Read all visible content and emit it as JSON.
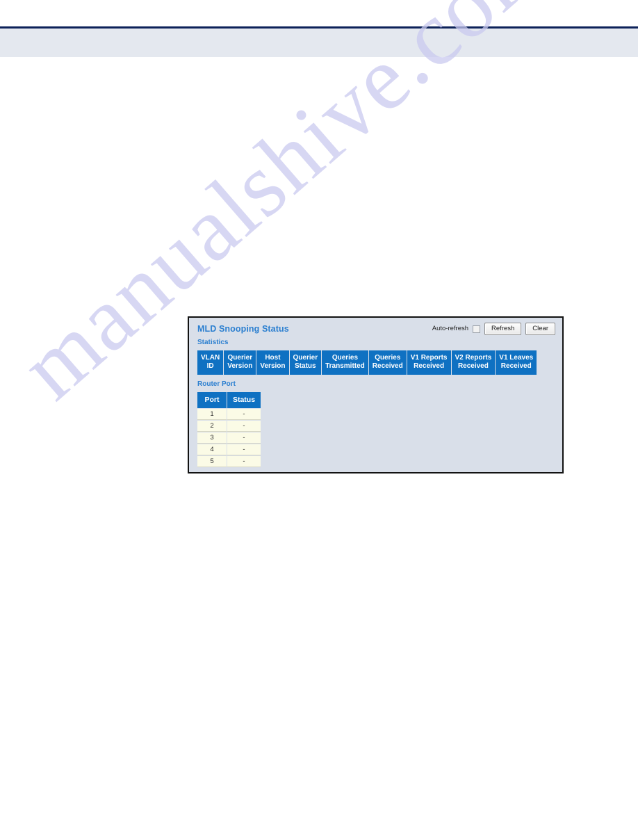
{
  "page": {
    "background_color": "#ffffff",
    "rule_color": "#0d2259",
    "band_color": "#e4e8ef"
  },
  "watermark": {
    "text": "manualshive.com",
    "color": "#c9c9ef"
  },
  "panel": {
    "title": "MLD Snooping Status",
    "accent_color": "#2b7fd0",
    "header_color": "#0f71c2",
    "background_color": "#d9dfe9",
    "row_color": "#fbfbe6",
    "toolbar": {
      "autorefresh_label": "Auto-refresh",
      "autorefresh_checked": false,
      "refresh_label": "Refresh",
      "clear_label": "Clear"
    },
    "statistics": {
      "section_label": "Statistics",
      "columns": [
        {
          "line1": "VLAN",
          "line2": "ID"
        },
        {
          "line1": "Querier",
          "line2": "Version"
        },
        {
          "line1": "Host",
          "line2": "Version"
        },
        {
          "line1": "Querier",
          "line2": "Status"
        },
        {
          "line1": "Queries",
          "line2": "Transmitted"
        },
        {
          "line1": "Queries",
          "line2": "Received"
        },
        {
          "line1": "V1 Reports",
          "line2": "Received"
        },
        {
          "line1": "V2 Reports",
          "line2": "Received"
        },
        {
          "line1": "V1 Leaves",
          "line2": "Received"
        }
      ],
      "rows": []
    },
    "router_port": {
      "section_label": "Router Port",
      "columns": [
        "Port",
        "Status"
      ],
      "rows": [
        {
          "port": "1",
          "status": "-"
        },
        {
          "port": "2",
          "status": "-"
        },
        {
          "port": "3",
          "status": "-"
        },
        {
          "port": "4",
          "status": "-"
        },
        {
          "port": "5",
          "status": "-"
        }
      ]
    }
  }
}
